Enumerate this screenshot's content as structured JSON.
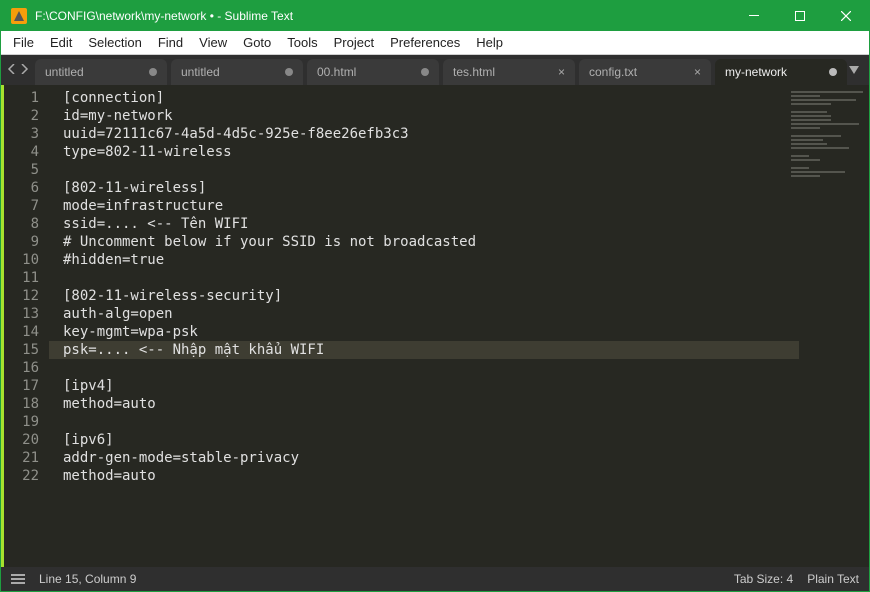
{
  "titlebar": {
    "title": "F:\\CONFIG\\network\\my-network • - Sublime Text"
  },
  "menu": {
    "items": [
      "File",
      "Edit",
      "Selection",
      "Find",
      "View",
      "Goto",
      "Tools",
      "Project",
      "Preferences",
      "Help"
    ]
  },
  "tabs": [
    {
      "label": "untitled",
      "dirty": true,
      "active": false
    },
    {
      "label": "untitled",
      "dirty": true,
      "active": false
    },
    {
      "label": "00.html",
      "dirty": true,
      "active": false
    },
    {
      "label": "tes.html",
      "dirty": false,
      "active": false
    },
    {
      "label": "config.txt",
      "dirty": false,
      "active": false
    },
    {
      "label": "my-network",
      "dirty": true,
      "active": true
    }
  ],
  "editor": {
    "highlight_line": 15,
    "lines": [
      "[connection]",
      "id=my-network",
      "uuid=72111c67-4a5d-4d5c-925e-f8ee26efb3c3",
      "type=802-11-wireless",
      "",
      "[802-11-wireless]",
      "mode=infrastructure",
      "ssid=.... <-- Tên WIFI",
      "# Uncomment below if your SSID is not broadcasted",
      "#hidden=true",
      "",
      "[802-11-wireless-security]",
      "auth-alg=open",
      "key-mgmt=wpa-psk",
      "psk=.... <-- Nhập mật khẩu WIFI",
      "",
      "[ipv4]",
      "method=auto",
      "",
      "[ipv6]",
      "addr-gen-mode=stable-privacy",
      "method=auto"
    ]
  },
  "statusbar": {
    "position": "Line 15, Column 9",
    "tab_size": "Tab Size: 4",
    "syntax": "Plain Text"
  }
}
